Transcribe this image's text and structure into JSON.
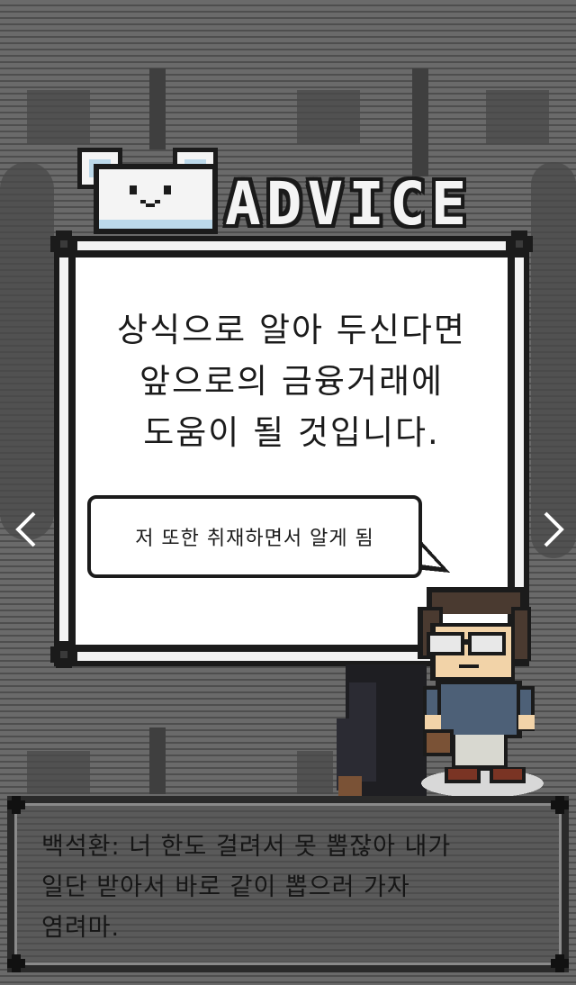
{
  "screen": {
    "title": "ADVICE",
    "mascot_icon": "bear-icon"
  },
  "advice": {
    "lines": [
      "상식으로 알아 두신다면",
      "앞으로의 금융거래에",
      "도움이 될 것입니다."
    ]
  },
  "speech_bubble": {
    "text": "저 또한 취재하면서 알게 됨"
  },
  "navigation": {
    "prev_icon": "chevron-left-icon",
    "next_icon": "chevron-right-icon"
  },
  "dialogue": {
    "lines": [
      "백석환: 너 한도 걸려서 못 뽑잖아 내가",
      "일단 받아서 바로 같이 뽑으러 가자",
      "염려마."
    ]
  },
  "colors": {
    "frame": "#1b1b1b",
    "card": "#ffffff",
    "background": "#5e5e5e"
  }
}
